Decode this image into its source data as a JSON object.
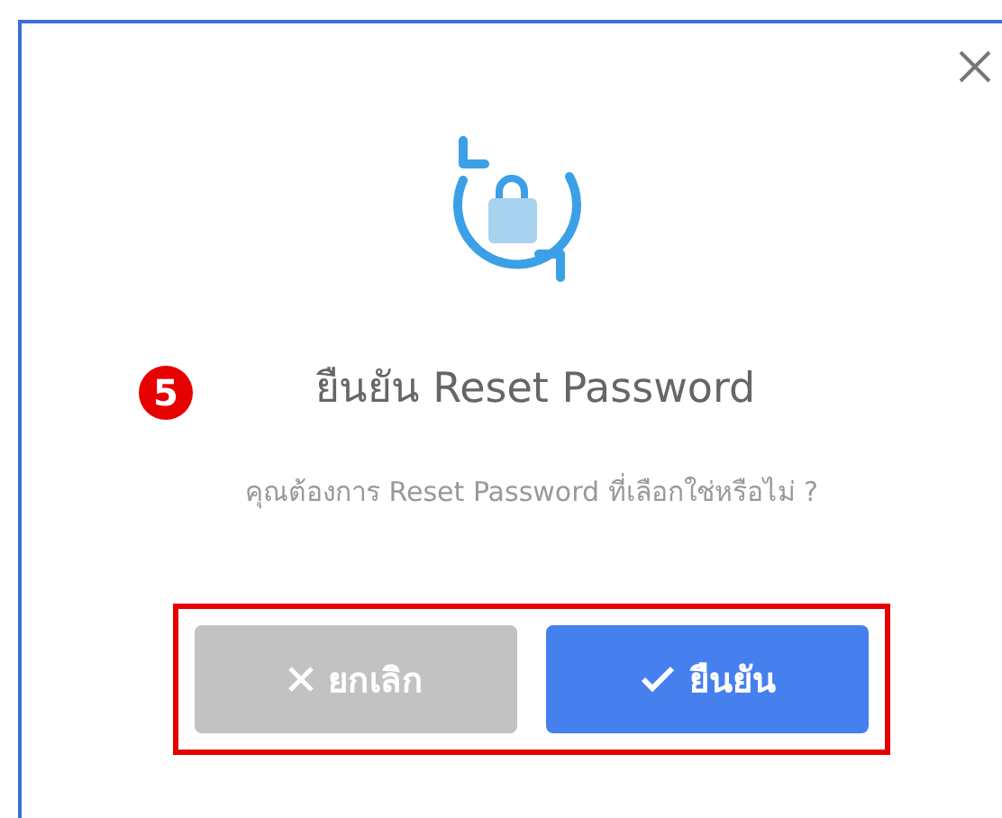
{
  "dialog": {
    "title": "ยืนยัน Reset Password",
    "message": "คุณต้องการ Reset Password ที่เลือกใช่หรือไม่ ?",
    "buttons": [
      {
        "label": "ยกเลิก",
        "kind": "cancel"
      },
      {
        "label": "ยืนยัน",
        "kind": "confirm"
      }
    ]
  },
  "annotation": {
    "step": "5"
  }
}
